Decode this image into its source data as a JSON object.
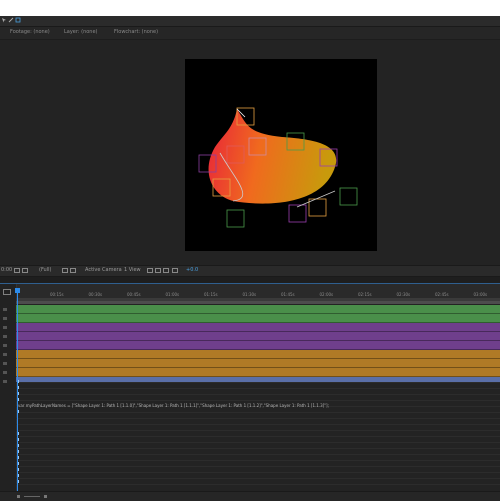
{
  "toolbar": {
    "icons": [
      "arrow-icon",
      "pen-icon",
      "anchor-icon"
    ]
  },
  "panel_tabs": [
    {
      "label": "Footage: (none)"
    },
    {
      "label": "Layer: (none)"
    },
    {
      "label": "Flowchart: (none)"
    }
  ],
  "viewer_bar": {
    "timecode": "0:00",
    "zoom": "(Full)",
    "camera": "Active Camera",
    "view": "1 View",
    "extra": "+0.0"
  },
  "timeline": {
    "ticks": [
      "00:15s",
      "00:30s",
      "00:45s",
      "01:00s",
      "01:15s",
      "01:30s",
      "01:45s",
      "02:00s",
      "02:15s",
      "02:30s",
      "02:45s",
      "03:00s"
    ],
    "tracks": [
      {
        "color": "#4a8f4a"
      },
      {
        "color": "#4a8f4a"
      },
      {
        "color": "#6f3f8c"
      },
      {
        "color": "#6f3f8c"
      },
      {
        "color": "#6f3f8c"
      },
      {
        "color": "#b07a26"
      },
      {
        "color": "#b07a26"
      },
      {
        "color": "#b07a26"
      },
      {
        "color": "#5a6fa8"
      }
    ],
    "expression": "var myPathLayerNames = [\"Shape Layer 1: Path 1 [1.1.0]\",\"Shape Layer 1: Path 1 [1.1.1]\",\"Shape Layer 1: Path 1 [1.1.2]\",\"Shape Layer 1: Path 1 [1.1.3]\"];"
  },
  "colors": {
    "accent": "#2d8ceb",
    "shape_gradient_start": "#e8233a",
    "shape_gradient_end": "#c89a0c"
  }
}
